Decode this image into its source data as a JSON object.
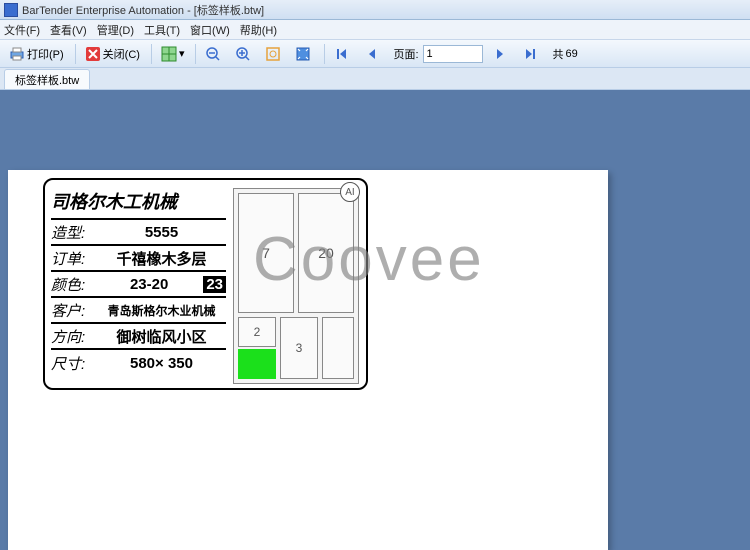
{
  "title": "BarTender Enterprise Automation - [标签样板.btw]",
  "menus": {
    "file": "文件(F)",
    "view": "查看(V)",
    "admin": "管理(D)",
    "tools": "工具(T)",
    "window": "窗口(W)",
    "help": "帮助(H)"
  },
  "toolbar": {
    "print": "打印(P)",
    "close": "关闭(C)",
    "page_label": "页面:",
    "page_value": "1",
    "total_prefix": "共",
    "total_value": "69"
  },
  "tab": {
    "name": "标签样板.btw"
  },
  "label": {
    "title": "司格尔木工机械",
    "style_k": "造型:",
    "style_v": "5555",
    "order_k": "订单:",
    "order_v": "千禧橡木多层",
    "color_k": "颜色:",
    "color_v": "23-20",
    "color_badge": "23",
    "cust_k": "客户:",
    "cust_v": "青岛斯格尔木业机械",
    "dir_k": "方向:",
    "dir_v": "御树临风小区",
    "size_k": "尺寸:",
    "size_v": "580× 350",
    "panel": {
      "p1": "7",
      "p2": "20",
      "p3": "2",
      "p4": "3"
    },
    "ai": "AI"
  },
  "watermark": "Coovee"
}
